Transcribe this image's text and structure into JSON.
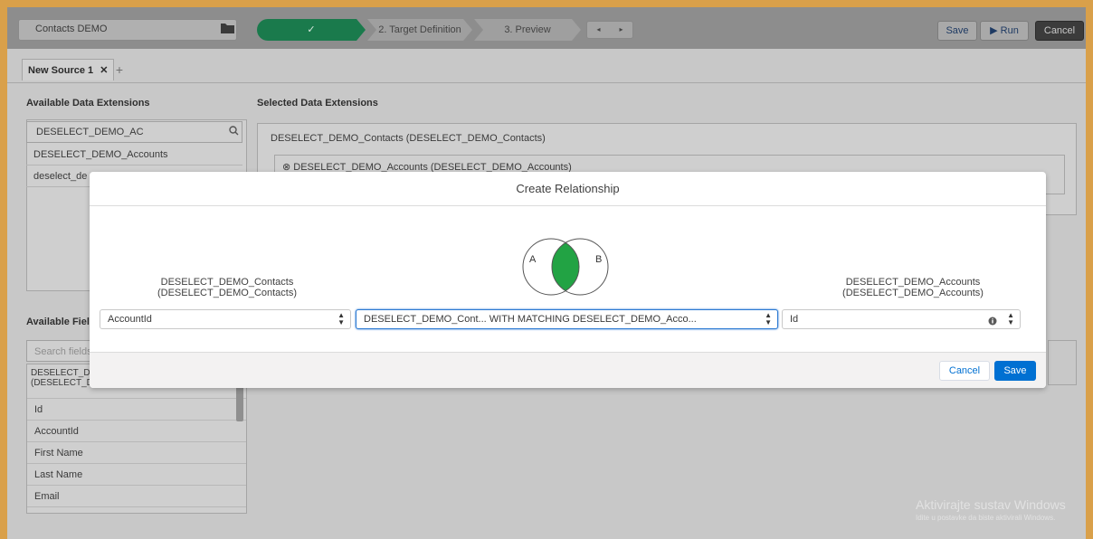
{
  "header": {
    "selection_name": "Contacts DEMO",
    "steps": [
      {
        "label": "✓"
      },
      {
        "label": "2. Target Definition"
      },
      {
        "label": "3. Preview"
      }
    ],
    "nav_prev": "◂",
    "nav_next": "▸",
    "save_label": "Save",
    "run_label": "▶ Run",
    "cancel_label": "Cancel"
  },
  "tabs": {
    "active_label": "New Source 1",
    "close_glyph": "✕",
    "add_glyph": "+"
  },
  "available_de": {
    "title": "Available Data Extensions",
    "search_value": "DESELECT_DEMO_AC",
    "items": [
      "DESELECT_DEMO_Accounts",
      "deselect_de"
    ]
  },
  "selected_de": {
    "title": "Selected Data Extensions",
    "primary": "DESELECT_DEMO_Contacts (DESELECT_DEMO_Contacts)",
    "joined": "DESELECT_DEMO_Accounts (DESELECT_DEMO_Accounts)"
  },
  "available_fields": {
    "title": "Available Fields",
    "search_placeholder": "Search fields",
    "group_line1": "DESELECT_DEMO_Contacts",
    "group_line2": "(DESELECT_DEMO_Contacts)",
    "fields": [
      "Id",
      "AccountId",
      "First Name",
      "Last Name",
      "Email"
    ]
  },
  "modal": {
    "title": "Create Relationship",
    "left_label_line1": "DESELECT_DEMO_Contacts",
    "left_label_line2": "(DESELECT_DEMO_Contacts)",
    "right_label_line1": "DESELECT_DEMO_Accounts",
    "right_label_line2": "(DESELECT_DEMO_Accounts)",
    "venn_a": "A",
    "venn_b": "B",
    "left_field": "AccountId",
    "relation_type": "DESELECT_DEMO_Cont... WITH MATCHING DESELECT_DEMO_Acco...",
    "right_field": "Id",
    "cancel_label": "Cancel",
    "save_label": "Save"
  },
  "watermark": {
    "line1": "Aktivirajte sustav Windows",
    "line2": "Idite u postavke da biste aktivirali Windows."
  },
  "colors": {
    "accent": "#0070d2",
    "venn_fill": "#22a344",
    "step_done": "#1a7a4c"
  }
}
